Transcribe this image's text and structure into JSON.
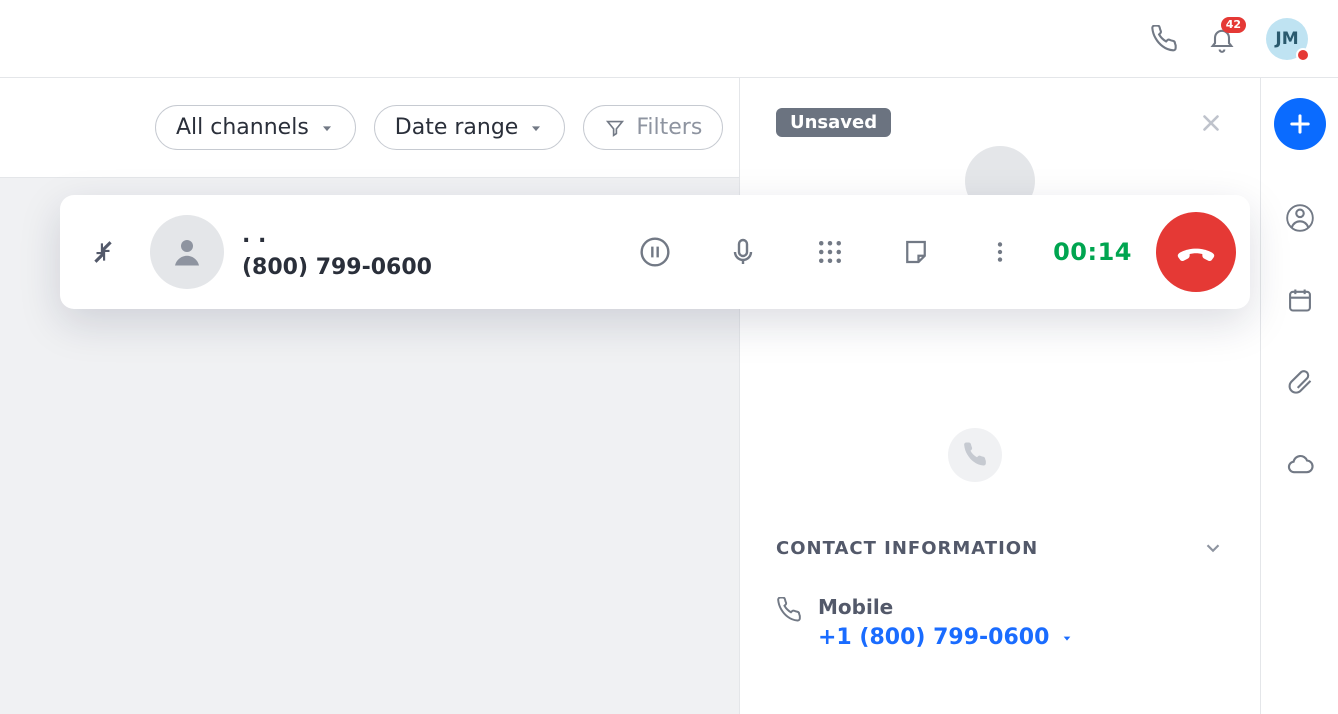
{
  "topbar": {
    "notification_count": "42",
    "avatar_initials": "JM"
  },
  "filters": {
    "channels_label": "All channels",
    "date_label": "Date range",
    "filters_label": "Filters"
  },
  "call": {
    "caller_name": ". .",
    "caller_number": "(800) 799-0600",
    "timer": "00:14"
  },
  "detail": {
    "tag": "Unsaved",
    "section_title": "CONTACT INFORMATION",
    "mobile_label": "Mobile",
    "mobile_value": "+1 (800) 799-0600"
  }
}
